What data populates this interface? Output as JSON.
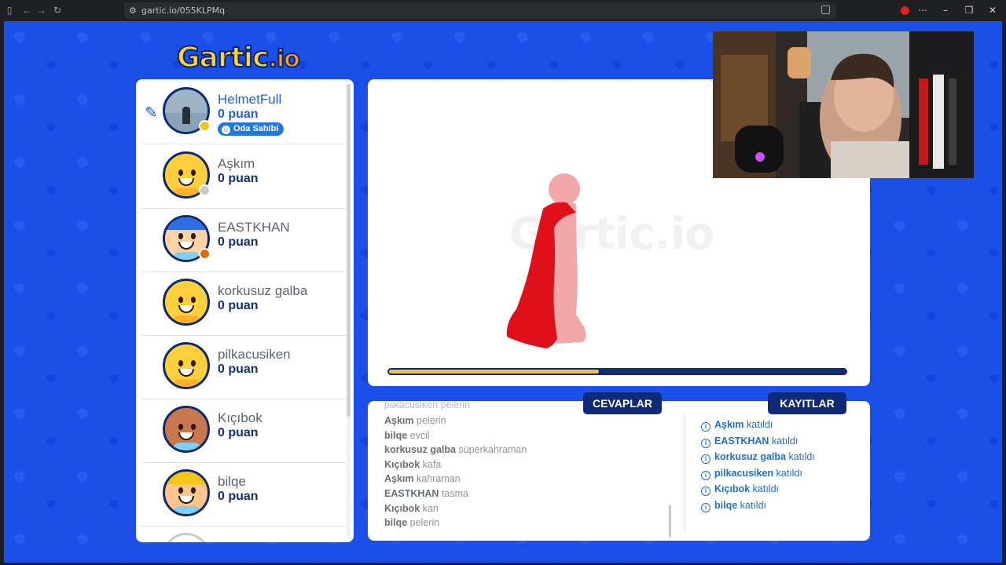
{
  "browser": {
    "url": "gartic.io/055KLPMq"
  },
  "logo": {
    "name": "Gartic",
    "suffix": ".io"
  },
  "players": [
    {
      "name": "HelmetFull",
      "points": "0 puan",
      "status_color": "#f5c518",
      "badge": "Oda Sahibi",
      "avatar": "photo"
    },
    {
      "name": "Aşkım",
      "points": "0 puan",
      "status_color": "#c9c9c9",
      "avatar": "yellow-smile"
    },
    {
      "name": "EASTKHAN",
      "points": "0 puan",
      "status_color": "#e06a12",
      "avatar": "blue-hair"
    },
    {
      "name": "korkusuz galba",
      "points": "0 puan",
      "avatar": "yellow-smile"
    },
    {
      "name": "pilkacusiken",
      "points": "0 puan",
      "avatar": "yellow-smile"
    },
    {
      "name": "Kıçıbok",
      "points": "0 puan",
      "avatar": "brown-smile"
    },
    {
      "name": "bilqe",
      "points": "0 puan",
      "avatar": "cap"
    }
  ],
  "canvas": {
    "watermark": "Gartic.io",
    "timer_fraction": 0.46
  },
  "tabs": {
    "answers": "CEVAPLAR",
    "records": "KAYITLAR"
  },
  "answers": [
    {
      "user": "Aşkım",
      "text": "pelerin"
    },
    {
      "user": "bilqe",
      "text": "evcil"
    },
    {
      "user": "korkusuz galba",
      "text": "süperkahraman"
    },
    {
      "user": "Kıçıbok",
      "text": "kafa"
    },
    {
      "user": "Aşkım",
      "text": "kahraman"
    },
    {
      "user": "EASTKHAN",
      "text": "tasma"
    },
    {
      "user": "Kıçıbok",
      "text": "kan"
    },
    {
      "user": "bilqe",
      "text": "pelerin"
    }
  ],
  "records": [
    {
      "user": "Aşkım",
      "text": "katıldı"
    },
    {
      "user": "EASTKHAN",
      "text": "katıldı"
    },
    {
      "user": "korkusuz galba",
      "text": "katıldı"
    },
    {
      "user": "pilkacusiken",
      "text": "katıldı"
    },
    {
      "user": "Kıçıbok",
      "text": "katıldı"
    },
    {
      "user": "bilqe",
      "text": "katıldı"
    }
  ],
  "colors": {
    "background": "#1a4fe8",
    "navy": "#0f2a77",
    "accent_yellow": "#f0c33a",
    "link_blue": "#1e6fd0"
  }
}
